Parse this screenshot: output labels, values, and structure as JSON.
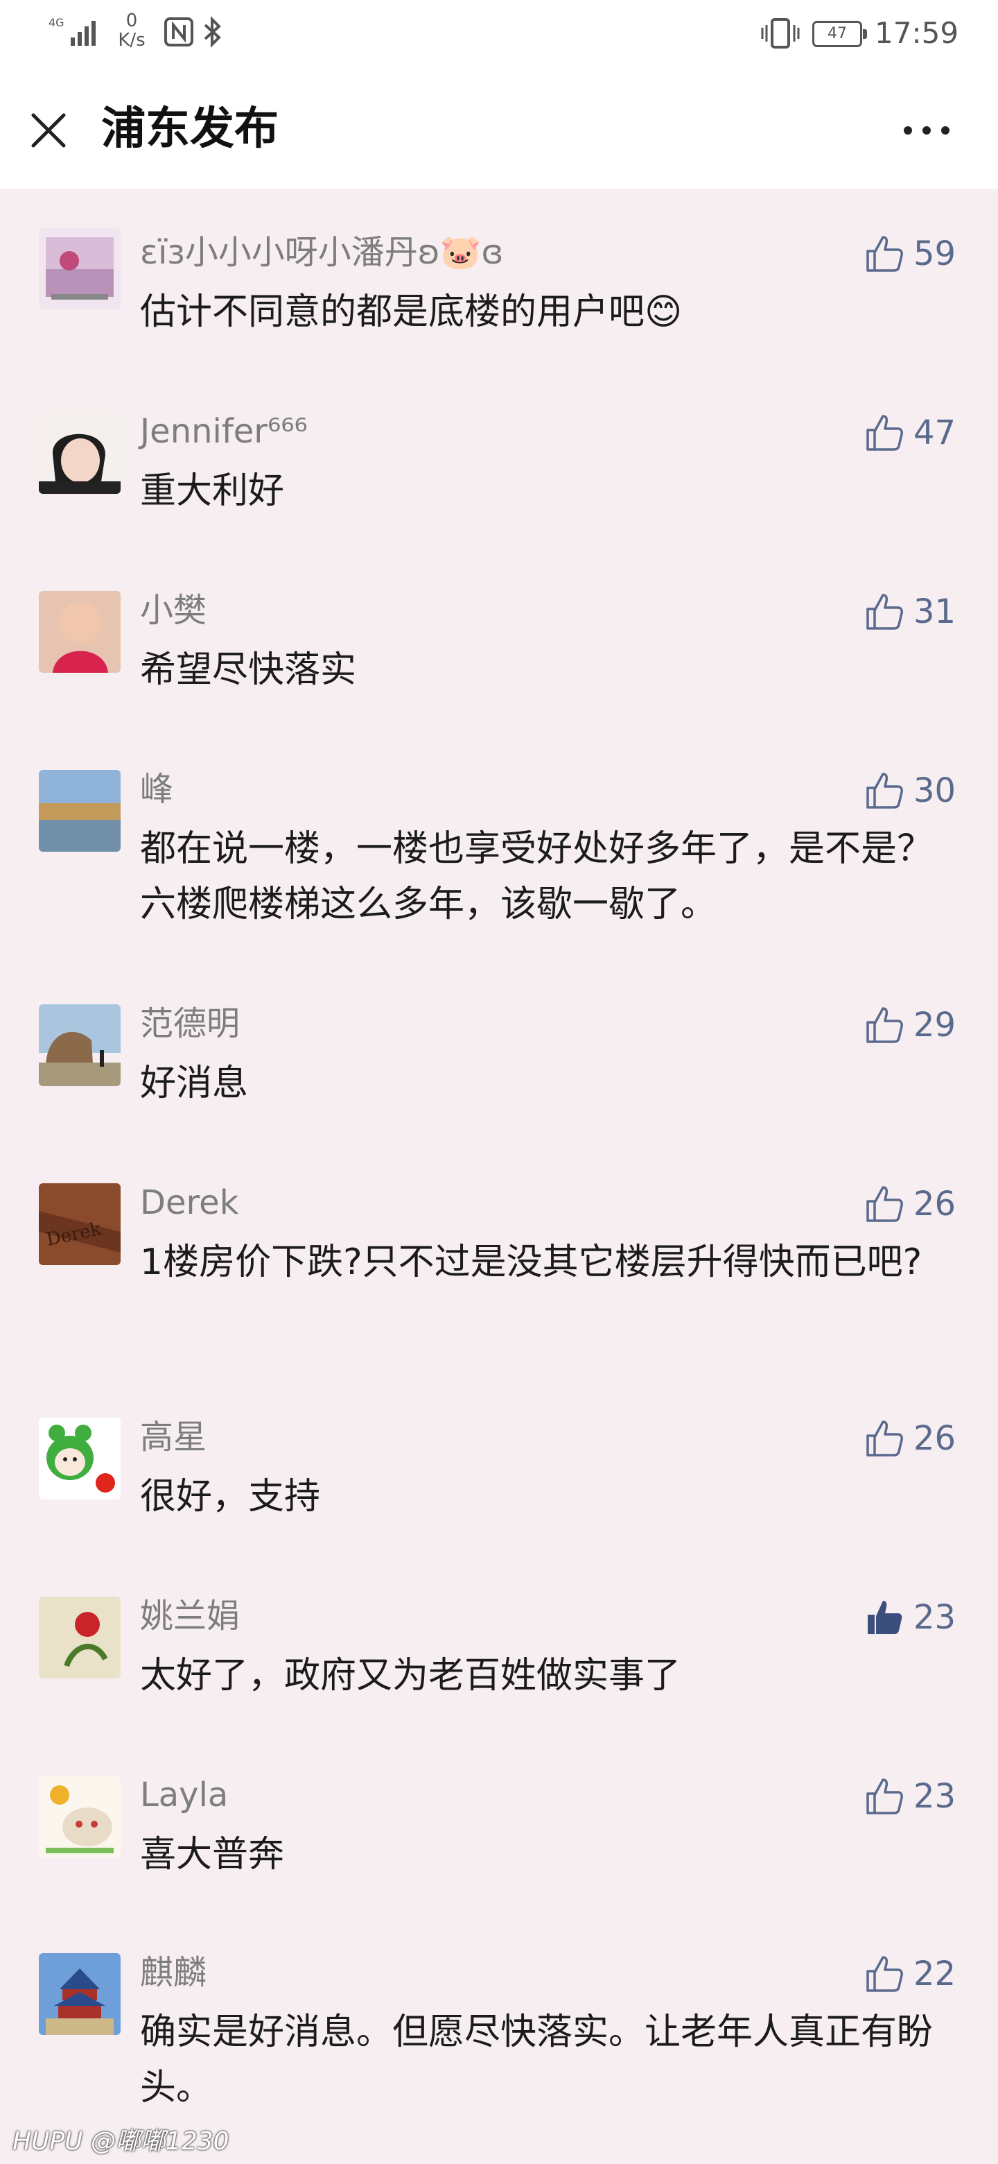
{
  "status_bar": {
    "signal_label": "4G",
    "net_speed_value": "0",
    "net_speed_unit": "K/s",
    "battery": "47",
    "time": "17:59"
  },
  "nav": {
    "title": "浦东发布",
    "close_icon": "close-icon",
    "more_icon": "more-icon"
  },
  "colors": {
    "background": "#f7eef2",
    "nickname": "#7d7d7d",
    "like_outline": "#5a6a8c",
    "like_filled": "#3b4f7d"
  },
  "comments": [
    {
      "nickname": "εïз小小小呀小潘丹ʚ🐷ɞ",
      "text": "估计不同意的都是底楼的用户吧😊",
      "likes": "59",
      "liked": false
    },
    {
      "nickname": "Jennifer⁶⁶⁶",
      "text": "重大利好",
      "likes": "47",
      "liked": false
    },
    {
      "nickname": "小樊",
      "text": "希望尽快落实",
      "likes": "31",
      "liked": false
    },
    {
      "nickname": "峰",
      "text": "都在说一楼，一楼也享受好处好多年了，是不是？六楼爬楼梯这么多年，该歇一歇了。",
      "likes": "30",
      "liked": false
    },
    {
      "nickname": "范德明",
      "text": "好消息",
      "likes": "29",
      "liked": false
    },
    {
      "nickname": "Derek",
      "text": "1楼房价下跌?只不过是没其它楼层升得快而已吧?",
      "likes": "26",
      "liked": false
    },
    {
      "nickname": "高星",
      "text": "很好，支持",
      "likes": "26",
      "liked": false
    },
    {
      "nickname": "姚兰娟",
      "text": "太好了，政府又为老百姓做实事了",
      "likes": "23",
      "liked": true
    },
    {
      "nickname": "Layla",
      "text": "喜大普奔",
      "likes": "23",
      "liked": false
    },
    {
      "nickname": "麒麟",
      "text": "确实是好消息。但愿尽快落实。让老年人真正有盼头。",
      "likes": "22",
      "liked": false
    }
  ],
  "watermark": "HUPU @嘟嘟1230"
}
